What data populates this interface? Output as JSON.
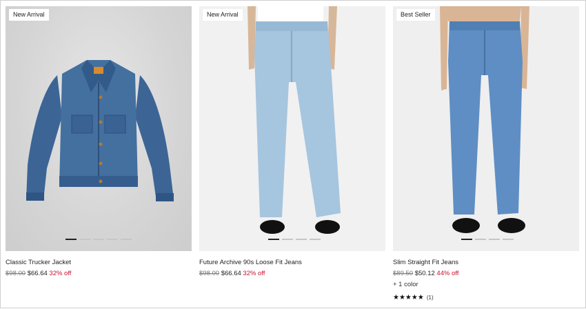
{
  "products": [
    {
      "badge": "New Arrival",
      "name": "Classic Trucker Jacket",
      "old_price": "$98.00",
      "new_price": "$66.64",
      "discount": "32% off"
    },
    {
      "badge": "New Arrival",
      "name": "Future Archive 90s Loose Fit Jeans",
      "old_price": "$98.00",
      "new_price": "$66.64",
      "discount": "32% off"
    },
    {
      "badge": "Best Seller",
      "name": "Slim Straight Fit Jeans",
      "old_price": "$89.50",
      "new_price": "$50.12",
      "discount": "44% off",
      "color_count": "+ 1 color",
      "stars": "★★★★★",
      "review_count": "(1)"
    }
  ],
  "colors": {
    "discount": "#c8102e",
    "denim_dark": "#3f679a",
    "denim_light": "#a9c8e2",
    "denim_mid": "#5f8fc6"
  }
}
